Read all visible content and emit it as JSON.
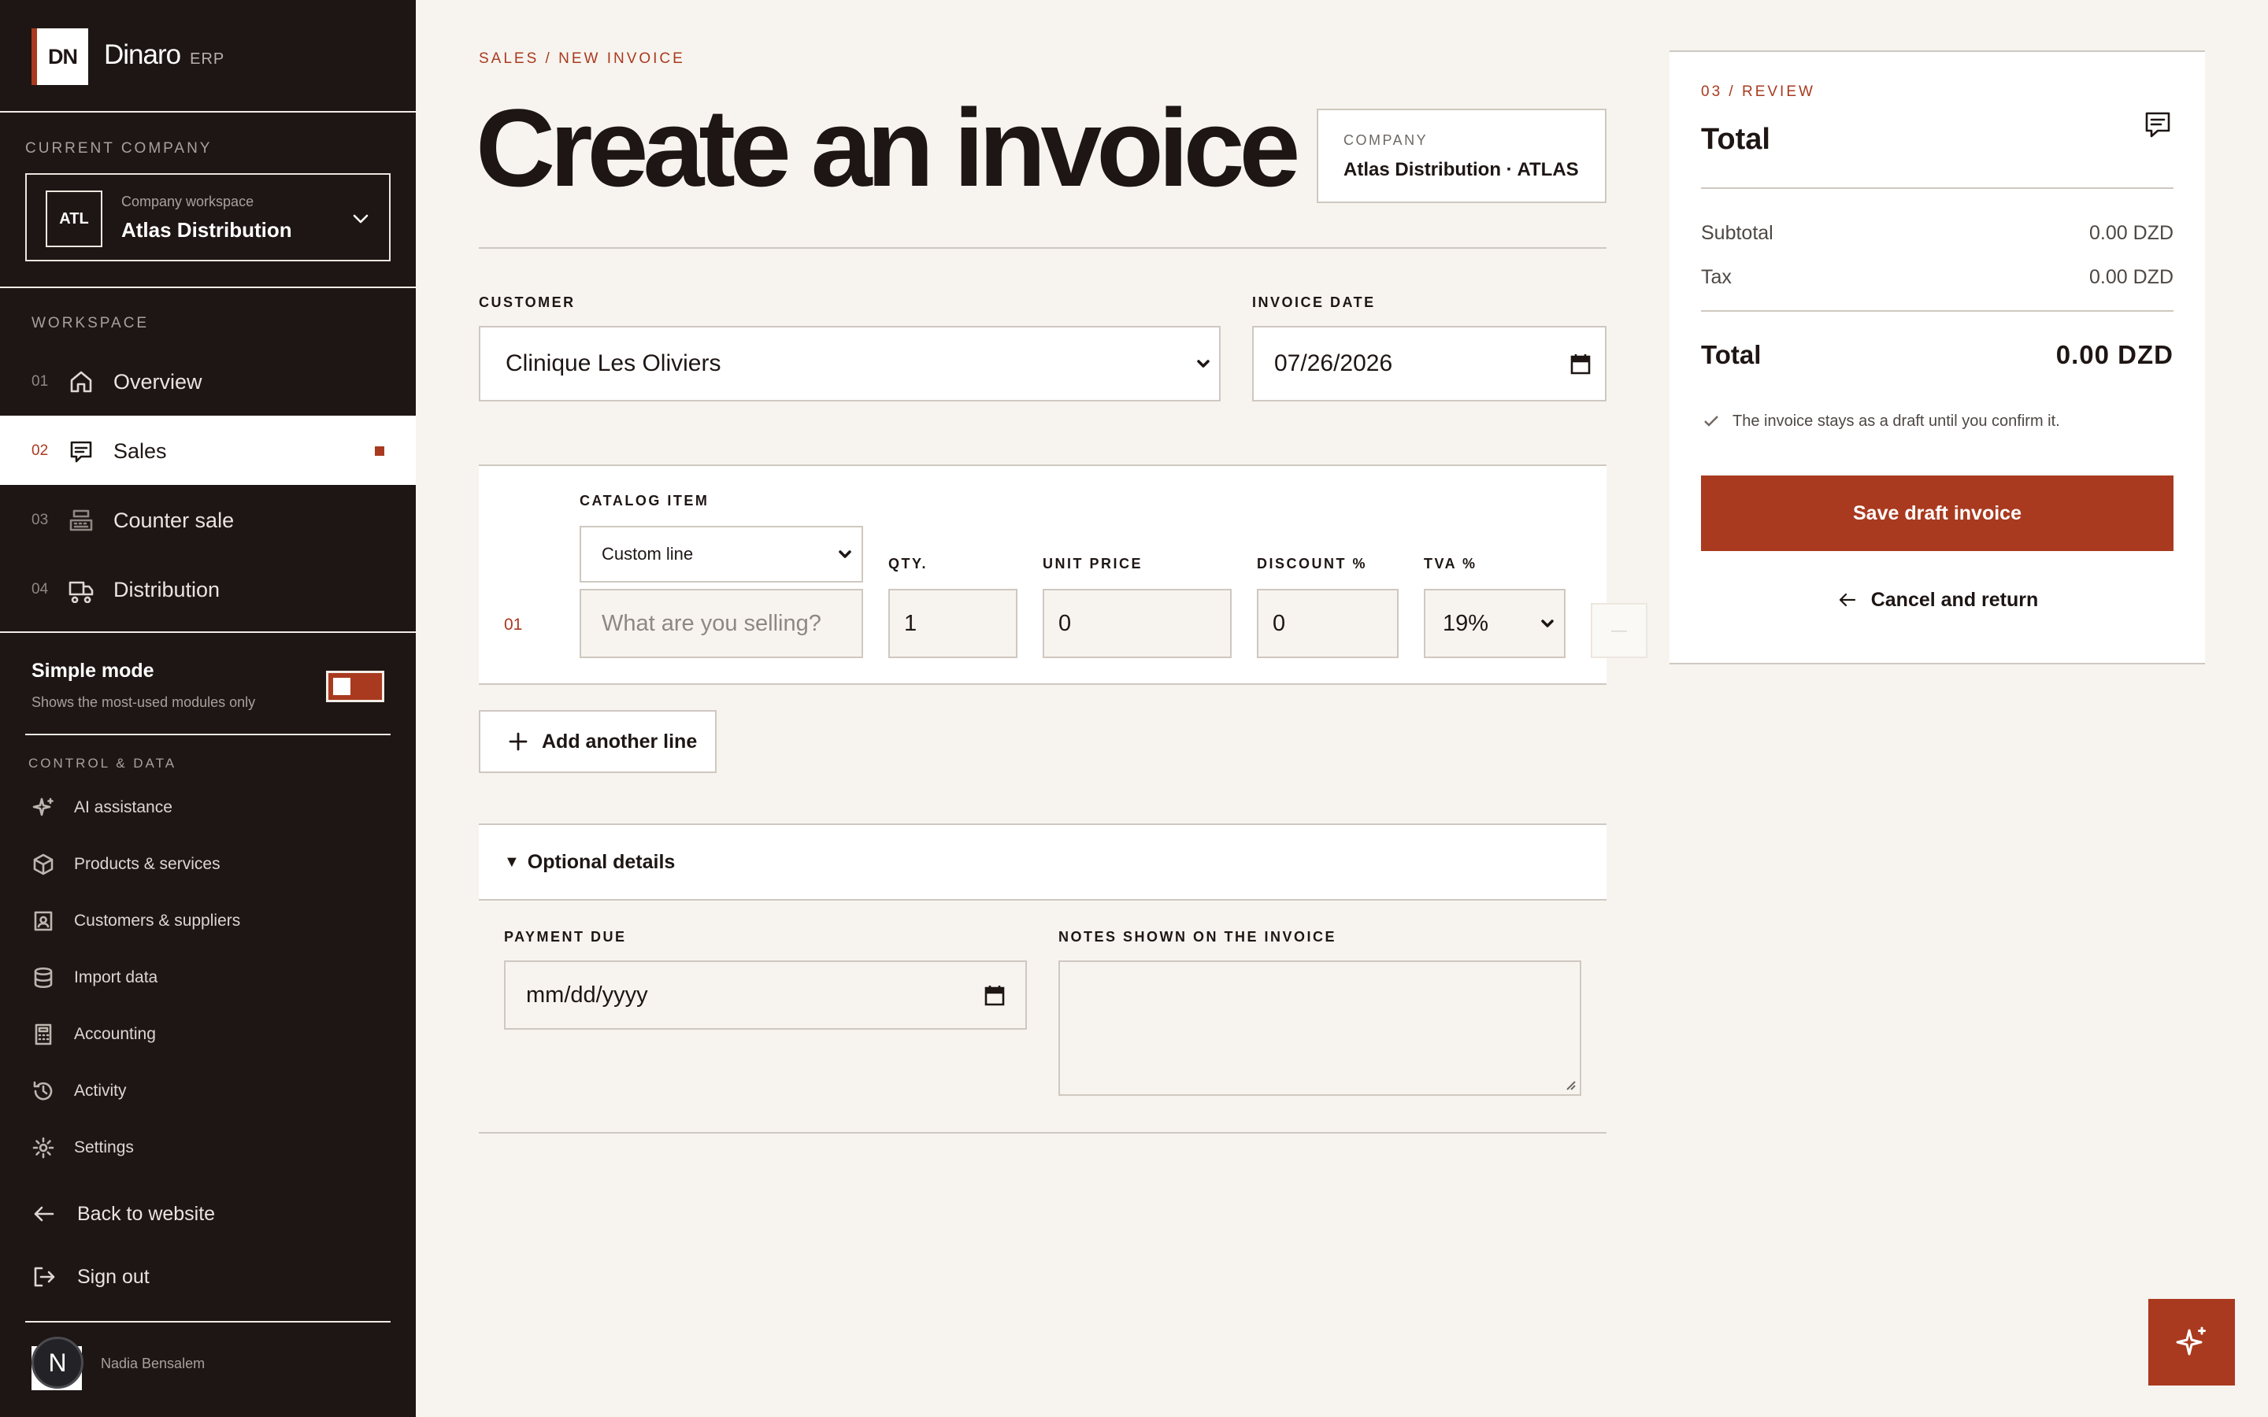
{
  "brand": {
    "mark": "DN",
    "name": "Dinaro",
    "suffix": "ERP"
  },
  "sidebar": {
    "company_section": "CURRENT COMPANY",
    "company": {
      "badge": "ATL",
      "caption": "Company workspace",
      "name": "Atlas Distribution"
    },
    "workspace_label": "WORKSPACE",
    "nav": [
      {
        "num": "01",
        "label": "Overview",
        "icon": "home-icon",
        "active": false
      },
      {
        "num": "02",
        "label": "Sales",
        "icon": "receipt-icon",
        "active": true
      },
      {
        "num": "03",
        "label": "Counter sale",
        "icon": "register-icon",
        "active": false
      },
      {
        "num": "04",
        "label": "Distribution",
        "icon": "truck-icon",
        "active": false
      }
    ],
    "simple_mode": {
      "title": "Simple mode",
      "subtitle": "Shows the most-used modules only",
      "on": false
    },
    "control_label": "CONTROL & DATA",
    "control_items": [
      {
        "label": "AI assistance",
        "icon": "sparkle-icon"
      },
      {
        "label": "Products & services",
        "icon": "box-icon"
      },
      {
        "label": "Customers & suppliers",
        "icon": "contact-icon"
      },
      {
        "label": "Import data",
        "icon": "database-icon"
      },
      {
        "label": "Accounting",
        "icon": "calculator-icon"
      },
      {
        "label": "Activity",
        "icon": "history-icon"
      },
      {
        "label": "Settings",
        "icon": "gear-icon"
      }
    ],
    "back_label": "Back to website",
    "signout_label": "Sign out",
    "user": {
      "initial": "N",
      "name": "Nadia Bensalem"
    }
  },
  "main": {
    "breadcrumb": "SALES / NEW INVOICE",
    "title": "Create an invoice",
    "company_box": {
      "label": "COMPANY",
      "value": "Atlas Distribution · ATLAS"
    },
    "customer": {
      "label": "CUSTOMER",
      "value": "Clinique Les Oliviers"
    },
    "invoice_date": {
      "label": "INVOICE DATE",
      "value": "07/26/2026"
    },
    "line": {
      "number": "01",
      "catalog_label": "CATALOG ITEM",
      "catalog_value": "Custom line",
      "description_placeholder": "What are you selling?",
      "qty_label": "QTY.",
      "qty": "1",
      "unit_price_label": "UNIT PRICE",
      "unit_price": "0",
      "discount_label": "DISCOUNT %",
      "discount": "0",
      "tva_label": "TVA %",
      "tva": "19%",
      "remove_glyph": "—"
    },
    "add_line_label": "Add another line",
    "optional": {
      "summary": "Optional details",
      "payment_due_label": "PAYMENT DUE",
      "payment_due_placeholder": "mm/dd/yyyy",
      "notes_label": "NOTES SHOWN ON THE INVOICE",
      "notes_value": ""
    }
  },
  "review": {
    "step": "03 / REVIEW",
    "title": "Total",
    "subtotal_label": "Subtotal",
    "subtotal": "0.00 DZD",
    "tax_label": "Tax",
    "tax": "0.00 DZD",
    "total_label": "Total",
    "total": "0.00 DZD",
    "note": "The invoice stays as a draft until you confirm it.",
    "save_label": "Save draft invoice",
    "cancel_label": "Cancel and return"
  },
  "colors": {
    "accent": "#a93a1f",
    "sidebar": "#1e1614",
    "page": "#f7f4ef"
  }
}
